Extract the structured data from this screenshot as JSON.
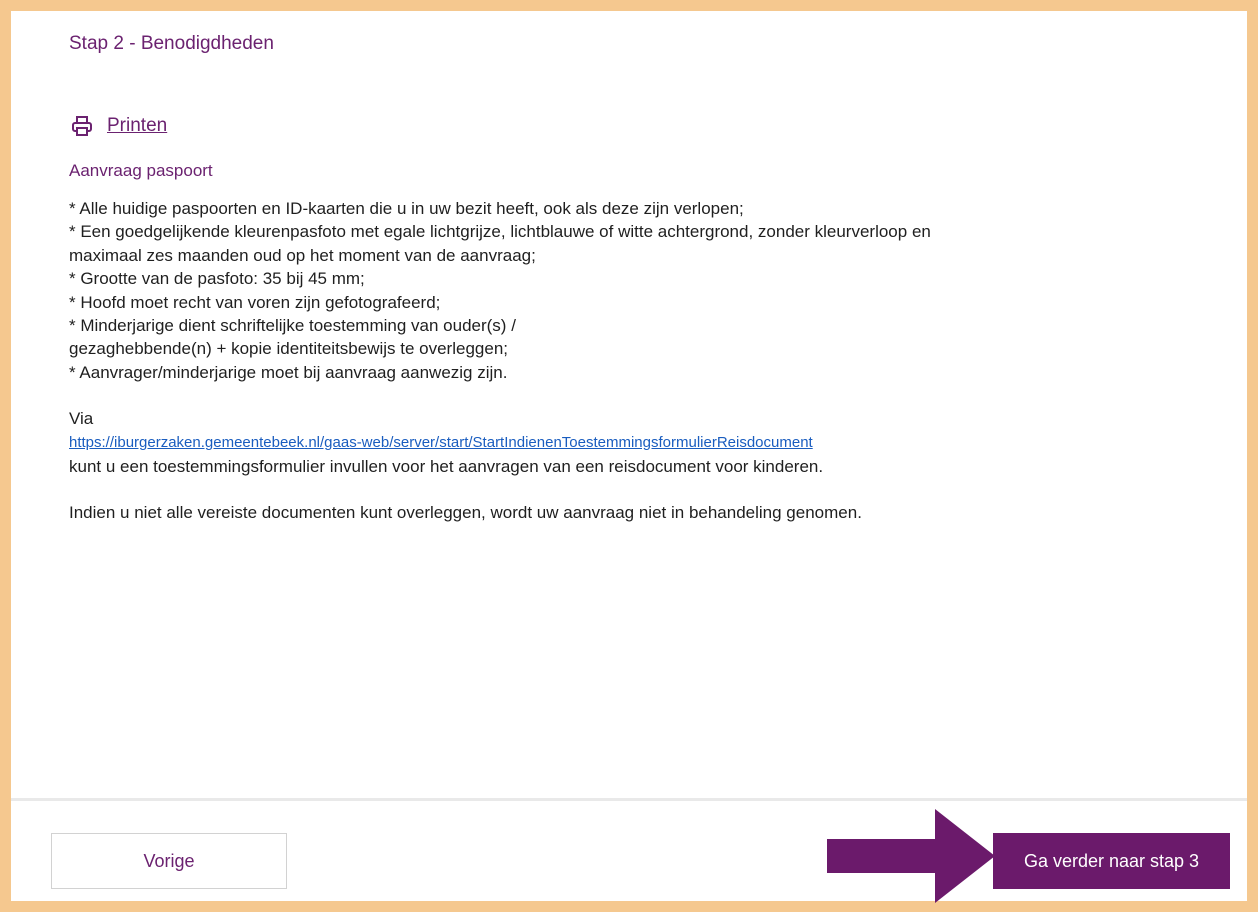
{
  "step_title": "Stap 2 - Benodigdheden",
  "print": {
    "icon": "printer-icon",
    "label": "Printen"
  },
  "section_title": "Aanvraag paspoort",
  "requirements": [
    "* Alle huidige paspoorten en ID-kaarten die u in uw bezit heeft, ook als deze zijn verlopen;",
    "* Een goedgelijkende kleurenpasfoto met egale lichtgrijze, lichtblauwe of witte achtergrond, zonder kleurverloop en",
    "maximaal zes maanden oud op het moment van de aanvraag;",
    "* Grootte van de pasfoto: 35 bij 45 mm;",
    "* Hoofd moet recht van voren zijn gefotografeerd;",
    "* Minderjarige dient schriftelijke toestemming van ouder(s) /",
    "gezaghebbende(n) + kopie identiteitsbewijs te overleggen;",
    "* Aanvrager/minderjarige moet bij aanvraag aanwezig zijn."
  ],
  "via_label": "Via",
  "via_url": "https://iburgerzaken.gemeentebeek.nl/gaas-web/server/start/StartIndienenToestemmingsformulierReisdocument",
  "via_text": "kunt u een  toestemmingsformulier invullen voor het aanvragen van een reisdocument voor kinderen.",
  "notice": "Indien u niet alle vereiste documenten kunt overleggen, wordt uw aanvraag niet in behandeling genomen.",
  "footer": {
    "prev_label": "Vorige",
    "next_label": "Ga verder naar stap 3",
    "arrow_icon": "arrow-right-icon"
  },
  "colors": {
    "frame": "#f5c88f",
    "accent": "#6b1a6b",
    "link": "#1a5dbf"
  }
}
